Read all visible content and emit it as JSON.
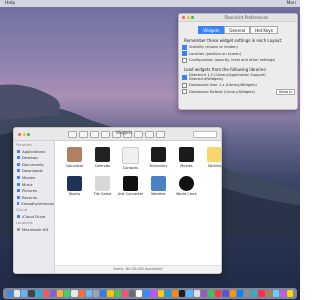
{
  "menubar": {
    "items": [
      "Help"
    ],
    "right": "Mon"
  },
  "prefs": {
    "title": "Übersicht Preferences",
    "tabs": [
      {
        "label": "Widgets",
        "selected": true
      },
      {
        "label": "General",
        "selected": false
      },
      {
        "label": "Hot Keys",
        "selected": false
      }
    ],
    "section1": "Remember these widget settings in each Layout:",
    "options1": [
      {
        "label": "Visibility (shown or hidden)",
        "checked": true
      },
      {
        "label": "Location (position on screen)",
        "checked": true
      },
      {
        "label": "Configuration (opacity, level and other settings)",
        "checked": false
      }
    ],
    "section2": "Load widgets from the following libraries:",
    "options2": [
      {
        "label": "Übersicht 1.5 (Library/Application Support/Übersicht/Widgets)",
        "checked": true
      },
      {
        "label": "Dashboard User 1.x (Library/Widgets)",
        "checked": false
      },
      {
        "label": "Dashboard Default (Library/Widgets)",
        "checked": false
      }
    ],
    "show_button": "Show in"
  },
  "finder": {
    "title": "Widgets",
    "sidebar": [
      {
        "header": "Favorites",
        "items": [
          "Applications",
          "Desktop",
          "Documents",
          "Downloads",
          "Movies",
          "Music",
          "Pictures",
          "Recents",
          "SmoothyVersions"
        ]
      },
      {
        "header": "iCloud",
        "items": [
          "iCloud Drive"
        ]
      },
      {
        "header": "Locations",
        "items": [
          "Macintosh HD"
        ]
      }
    ],
    "items": [
      {
        "label": "Calculator",
        "color": "#b08060"
      },
      {
        "label": "Calendar",
        "color": "#222222"
      },
      {
        "label": "Contacts",
        "color": "#f0f0f0"
      },
      {
        "label": "Dictionary",
        "color": "#1c1c1c"
      },
      {
        "label": "Movies",
        "color": "#1a1a1a"
      },
      {
        "label": "Stickies",
        "color": "#f8d66a"
      },
      {
        "label": "Stocks",
        "color": "#1d3458"
      },
      {
        "label": "Tile Game",
        "color": "#d8d8d8"
      },
      {
        "label": "Unit Converter",
        "color": "#111111"
      },
      {
        "label": "Weather",
        "color": "#4a82c4"
      },
      {
        "label": "World Clock",
        "color": "#111111"
      }
    ],
    "status": "items, 84 GB (85 available)"
  },
  "dock": {
    "colors": [
      "#3c8ce8",
      "#e6e6e6",
      "#5fb3f8",
      "#444",
      "#2eaadc",
      "#f05a5a",
      "#8a5bd6",
      "#ffb02e",
      "#3fd06a",
      "#e8e8e8",
      "#ff6b2e",
      "#60c0ff",
      "#9aa4b4",
      "#2e7df0",
      "#f2c400",
      "#4bc55e",
      "#ff4d70",
      "#6b6b6b",
      "#ffffff",
      "#2f8cff",
      "#c94dff",
      "#ffcc00",
      "#18a0e0",
      "#ff8a00",
      "#1e1e1e",
      "#58b6ff",
      "#e0e0e0",
      "#9b59b6",
      "#34c759",
      "#ff3b30",
      "#5856d6",
      "#ff9500",
      "#0a84ff",
      "#8e8e93",
      "#30b0c7",
      "#ff2d55",
      "#a2845e",
      "#64d2ff",
      "#bf5af2",
      "#ffd60a"
    ]
  }
}
